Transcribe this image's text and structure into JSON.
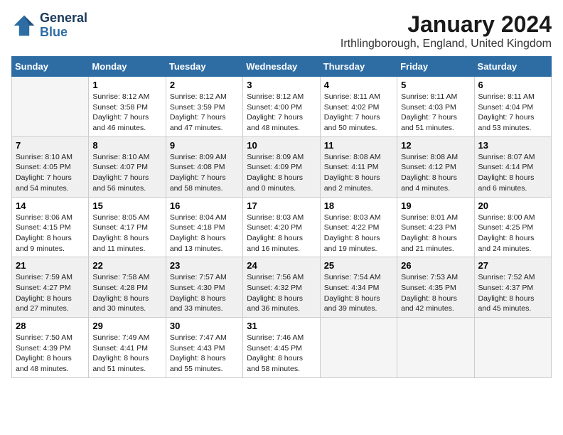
{
  "header": {
    "logo_line1": "General",
    "logo_line2": "Blue",
    "month": "January 2024",
    "location": "Irthlingborough, England, United Kingdom"
  },
  "weekdays": [
    "Sunday",
    "Monday",
    "Tuesday",
    "Wednesday",
    "Thursday",
    "Friday",
    "Saturday"
  ],
  "weeks": [
    [
      {
        "day": "",
        "sunrise": "",
        "sunset": "",
        "daylight": ""
      },
      {
        "day": "1",
        "sunrise": "Sunrise: 8:12 AM",
        "sunset": "Sunset: 3:58 PM",
        "daylight": "Daylight: 7 hours and 46 minutes."
      },
      {
        "day": "2",
        "sunrise": "Sunrise: 8:12 AM",
        "sunset": "Sunset: 3:59 PM",
        "daylight": "Daylight: 7 hours and 47 minutes."
      },
      {
        "day": "3",
        "sunrise": "Sunrise: 8:12 AM",
        "sunset": "Sunset: 4:00 PM",
        "daylight": "Daylight: 7 hours and 48 minutes."
      },
      {
        "day": "4",
        "sunrise": "Sunrise: 8:11 AM",
        "sunset": "Sunset: 4:02 PM",
        "daylight": "Daylight: 7 hours and 50 minutes."
      },
      {
        "day": "5",
        "sunrise": "Sunrise: 8:11 AM",
        "sunset": "Sunset: 4:03 PM",
        "daylight": "Daylight: 7 hours and 51 minutes."
      },
      {
        "day": "6",
        "sunrise": "Sunrise: 8:11 AM",
        "sunset": "Sunset: 4:04 PM",
        "daylight": "Daylight: 7 hours and 53 minutes."
      }
    ],
    [
      {
        "day": "7",
        "sunrise": "Sunrise: 8:10 AM",
        "sunset": "Sunset: 4:05 PM",
        "daylight": "Daylight: 7 hours and 54 minutes."
      },
      {
        "day": "8",
        "sunrise": "Sunrise: 8:10 AM",
        "sunset": "Sunset: 4:07 PM",
        "daylight": "Daylight: 7 hours and 56 minutes."
      },
      {
        "day": "9",
        "sunrise": "Sunrise: 8:09 AM",
        "sunset": "Sunset: 4:08 PM",
        "daylight": "Daylight: 7 hours and 58 minutes."
      },
      {
        "day": "10",
        "sunrise": "Sunrise: 8:09 AM",
        "sunset": "Sunset: 4:09 PM",
        "daylight": "Daylight: 8 hours and 0 minutes."
      },
      {
        "day": "11",
        "sunrise": "Sunrise: 8:08 AM",
        "sunset": "Sunset: 4:11 PM",
        "daylight": "Daylight: 8 hours and 2 minutes."
      },
      {
        "day": "12",
        "sunrise": "Sunrise: 8:08 AM",
        "sunset": "Sunset: 4:12 PM",
        "daylight": "Daylight: 8 hours and 4 minutes."
      },
      {
        "day": "13",
        "sunrise": "Sunrise: 8:07 AM",
        "sunset": "Sunset: 4:14 PM",
        "daylight": "Daylight: 8 hours and 6 minutes."
      }
    ],
    [
      {
        "day": "14",
        "sunrise": "Sunrise: 8:06 AM",
        "sunset": "Sunset: 4:15 PM",
        "daylight": "Daylight: 8 hours and 9 minutes."
      },
      {
        "day": "15",
        "sunrise": "Sunrise: 8:05 AM",
        "sunset": "Sunset: 4:17 PM",
        "daylight": "Daylight: 8 hours and 11 minutes."
      },
      {
        "day": "16",
        "sunrise": "Sunrise: 8:04 AM",
        "sunset": "Sunset: 4:18 PM",
        "daylight": "Daylight: 8 hours and 13 minutes."
      },
      {
        "day": "17",
        "sunrise": "Sunrise: 8:03 AM",
        "sunset": "Sunset: 4:20 PM",
        "daylight": "Daylight: 8 hours and 16 minutes."
      },
      {
        "day": "18",
        "sunrise": "Sunrise: 8:03 AM",
        "sunset": "Sunset: 4:22 PM",
        "daylight": "Daylight: 8 hours and 19 minutes."
      },
      {
        "day": "19",
        "sunrise": "Sunrise: 8:01 AM",
        "sunset": "Sunset: 4:23 PM",
        "daylight": "Daylight: 8 hours and 21 minutes."
      },
      {
        "day": "20",
        "sunrise": "Sunrise: 8:00 AM",
        "sunset": "Sunset: 4:25 PM",
        "daylight": "Daylight: 8 hours and 24 minutes."
      }
    ],
    [
      {
        "day": "21",
        "sunrise": "Sunrise: 7:59 AM",
        "sunset": "Sunset: 4:27 PM",
        "daylight": "Daylight: 8 hours and 27 minutes."
      },
      {
        "day": "22",
        "sunrise": "Sunrise: 7:58 AM",
        "sunset": "Sunset: 4:28 PM",
        "daylight": "Daylight: 8 hours and 30 minutes."
      },
      {
        "day": "23",
        "sunrise": "Sunrise: 7:57 AM",
        "sunset": "Sunset: 4:30 PM",
        "daylight": "Daylight: 8 hours and 33 minutes."
      },
      {
        "day": "24",
        "sunrise": "Sunrise: 7:56 AM",
        "sunset": "Sunset: 4:32 PM",
        "daylight": "Daylight: 8 hours and 36 minutes."
      },
      {
        "day": "25",
        "sunrise": "Sunrise: 7:54 AM",
        "sunset": "Sunset: 4:34 PM",
        "daylight": "Daylight: 8 hours and 39 minutes."
      },
      {
        "day": "26",
        "sunrise": "Sunrise: 7:53 AM",
        "sunset": "Sunset: 4:35 PM",
        "daylight": "Daylight: 8 hours and 42 minutes."
      },
      {
        "day": "27",
        "sunrise": "Sunrise: 7:52 AM",
        "sunset": "Sunset: 4:37 PM",
        "daylight": "Daylight: 8 hours and 45 minutes."
      }
    ],
    [
      {
        "day": "28",
        "sunrise": "Sunrise: 7:50 AM",
        "sunset": "Sunset: 4:39 PM",
        "daylight": "Daylight: 8 hours and 48 minutes."
      },
      {
        "day": "29",
        "sunrise": "Sunrise: 7:49 AM",
        "sunset": "Sunset: 4:41 PM",
        "daylight": "Daylight: 8 hours and 51 minutes."
      },
      {
        "day": "30",
        "sunrise": "Sunrise: 7:47 AM",
        "sunset": "Sunset: 4:43 PM",
        "daylight": "Daylight: 8 hours and 55 minutes."
      },
      {
        "day": "31",
        "sunrise": "Sunrise: 7:46 AM",
        "sunset": "Sunset: 4:45 PM",
        "daylight": "Daylight: 8 hours and 58 minutes."
      },
      {
        "day": "",
        "sunrise": "",
        "sunset": "",
        "daylight": ""
      },
      {
        "day": "",
        "sunrise": "",
        "sunset": "",
        "daylight": ""
      },
      {
        "day": "",
        "sunrise": "",
        "sunset": "",
        "daylight": ""
      }
    ]
  ]
}
